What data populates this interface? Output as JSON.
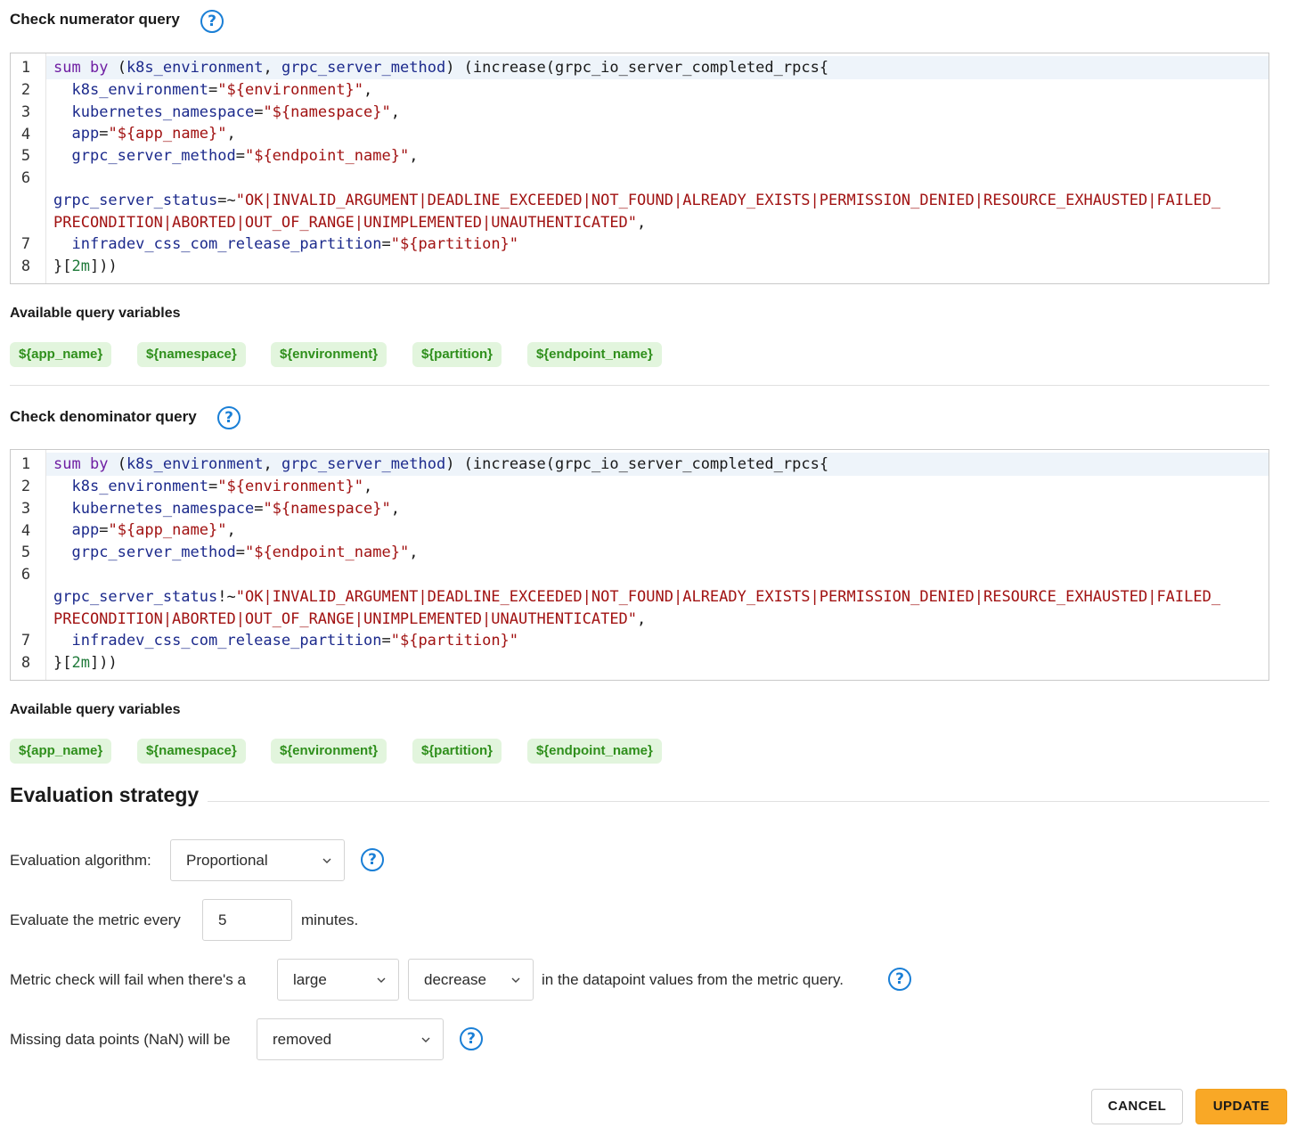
{
  "numerator": {
    "title": "Check numerator query",
    "variables_label": "Available query variables",
    "line_numbers": [
      "1",
      "2",
      "3",
      "4",
      "5",
      "6",
      "",
      "7",
      "8"
    ],
    "status_operator": "=~"
  },
  "denominator": {
    "title": "Check denominator query",
    "variables_label": "Available query variables",
    "line_numbers": [
      "1",
      "2",
      "3",
      "4",
      "5",
      "6",
      "",
      "7",
      "8"
    ],
    "status_operator": "!~"
  },
  "code_tokens": {
    "sum": "sum",
    "by": "by",
    "group_open": " (",
    "group_k8s": "k8s_environment",
    "comma_space": ", ",
    "group_method": "grpc_server_method",
    "increase": ") (increase(grpc_io_server_completed_rpcs{",
    "k8s_env_key": "k8s_environment",
    "k8s_env_val": "\"${environment}\"",
    "ns_key": "kubernetes_namespace",
    "ns_val": "\"${namespace}\"",
    "app_key": "app",
    "app_val": "\"${app_name}\"",
    "method_key": "grpc_server_method",
    "method_val": "\"${endpoint_name}\"",
    "status_key": "grpc_server_status",
    "status_val_1": "\"OK|INVALID_ARGUMENT|DEADLINE_EXCEEDED|NOT_FOUND|ALREADY_EXISTS|PERMISSION_DENIED|RESOURCE_EXHAUSTED|FAILED_",
    "status_val_2": "PRECONDITION|ABORTED|OUT_OF_RANGE|UNIMPLEMENTED|UNAUTHENTICATED\"",
    "partition_key": "infradev_css_com_release_partition",
    "partition_val": "\"${partition}\"",
    "close_open": "}[",
    "range": "2m",
    "close_end": "]))",
    "eq": "=",
    "comma": ","
  },
  "query_variables": [
    "${app_name}",
    "${namespace}",
    "${environment}",
    "${partition}",
    "${endpoint_name}"
  ],
  "evaluation": {
    "title": "Evaluation strategy",
    "algorithm_label": "Evaluation algorithm:",
    "algorithm_value": "Proportional",
    "every_prefix": "Evaluate the metric every",
    "every_value": "5",
    "every_suffix": "minutes.",
    "fail_prefix": "Metric check will fail when there's a",
    "fail_size": "large",
    "fail_direction": "decrease",
    "fail_suffix": "in the datapoint values from the metric query.",
    "missing_prefix": "Missing data points (NaN) will be",
    "missing_value": "removed"
  },
  "actions": {
    "cancel": "CANCEL",
    "update": "UPDATE"
  },
  "help_glyph": "?",
  "colors": {
    "accent_blue": "#1a7fd6",
    "update_orange": "#f9a826",
    "chip_bg": "#e2f5dd",
    "chip_text": "#2f8f1c"
  }
}
